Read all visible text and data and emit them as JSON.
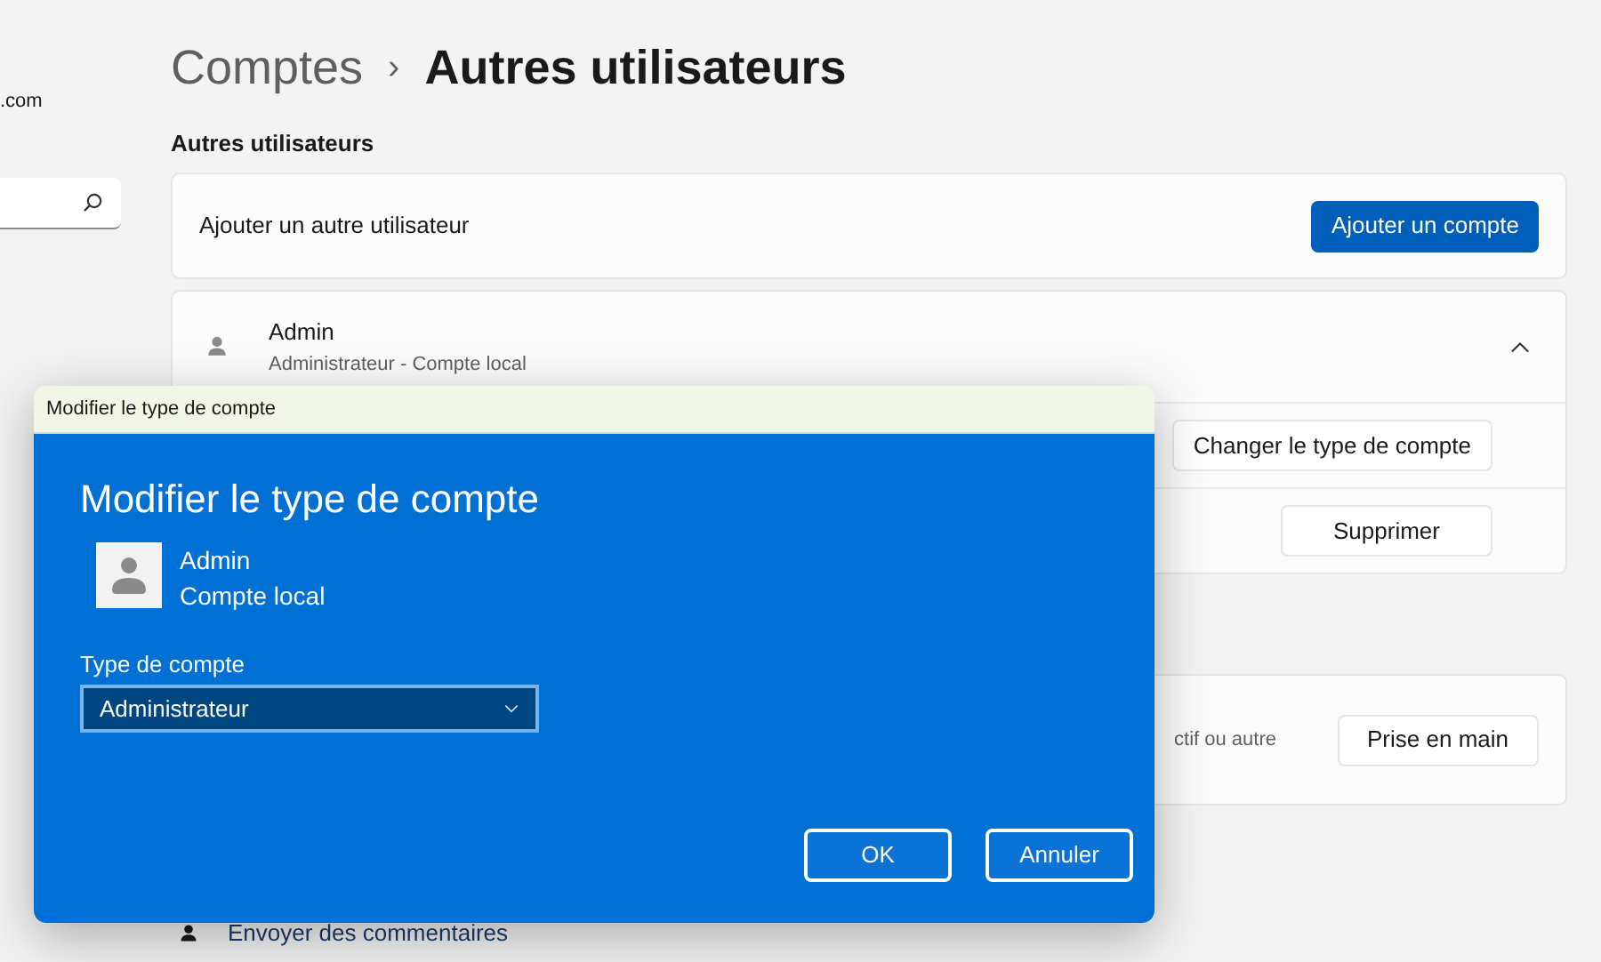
{
  "sidebar": {
    "email_fragment": ".com"
  },
  "breadcrumb": {
    "parent": "Comptes",
    "separator": "›",
    "current": "Autres utilisateurs"
  },
  "section_title": "Autres utilisateurs",
  "add_user": {
    "label": "Ajouter un autre utilisateur",
    "button": "Ajouter un compte"
  },
  "user": {
    "name": "Admin",
    "subtitle": "Administrateur - Compte local",
    "expanded": true,
    "actions": [
      "Changer le type de compte",
      "Supprimer"
    ]
  },
  "kiosk": {
    "description": "ctif ou autre",
    "button": "Prise en main"
  },
  "feedback_link": "Envoyer des commentaires",
  "dialog": {
    "window_title": "Modifier le type de compte",
    "heading": "Modifier le type de compte",
    "user_name": "Admin",
    "user_type": "Compte local",
    "field_label": "Type de compte",
    "value": "Administrateur",
    "buttons": [
      "OK",
      "Annuler"
    ]
  }
}
